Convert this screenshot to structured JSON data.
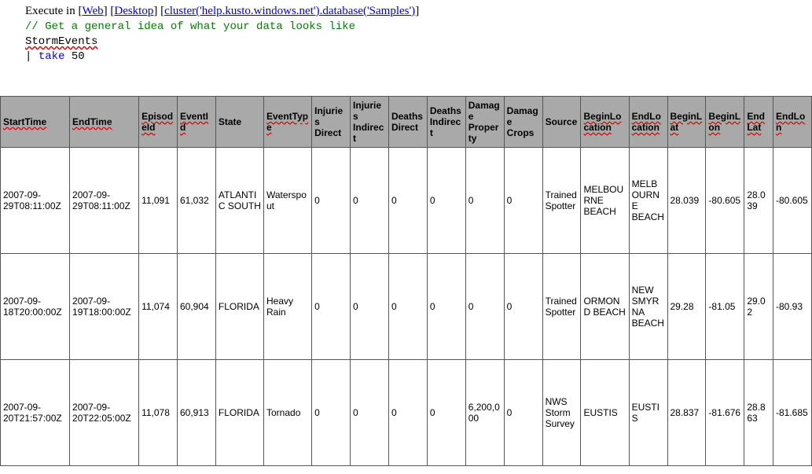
{
  "exec": {
    "prefix": "Execute in ",
    "web": "Web",
    "desktop": "Desktop",
    "cluster": "cluster('help.kusto.windows.net').database('Samples')"
  },
  "code": {
    "comment": "// Get a general idea of what your data looks like",
    "table": "StormEvents",
    "pipe": "| ",
    "take_kw": "take",
    "take_arg": " 50"
  },
  "headers": [
    {
      "t": "StartTime",
      "wavy": true
    },
    {
      "t": "EndTime",
      "wavy": true
    },
    {
      "t": "EpisodeId",
      "wavy": true
    },
    {
      "t": "EventId",
      "wavy": true
    },
    {
      "t": "State",
      "wavy": false
    },
    {
      "t": "EventType",
      "wavy": true
    },
    {
      "t": "Injuries Direct",
      "wavy": false
    },
    {
      "t": "Injuries Indirect",
      "wavy": false
    },
    {
      "t": "Deaths Direct",
      "wavy": false
    },
    {
      "t": "Deaths Indirect",
      "wavy": false
    },
    {
      "t": "Damage Property",
      "wavy": false
    },
    {
      "t": "Damage Crops",
      "wavy": false
    },
    {
      "t": "Source",
      "wavy": false
    },
    {
      "t": "BeginLocation",
      "wavy": true
    },
    {
      "t": "EndLocation",
      "wavy": true
    },
    {
      "t": "BeginLat",
      "wavy": true
    },
    {
      "t": "BeginLon",
      "wavy": true
    },
    {
      "t": "EndLat",
      "wavy": true
    },
    {
      "t": "EndLon",
      "wavy": true
    }
  ],
  "rows": [
    [
      "2007-09-29T08:11:00Z",
      "2007-09-29T08:11:00Z",
      "11,091",
      "61,032",
      "ATLANTIC SOUTH",
      "Waterspout",
      "0",
      "0",
      "0",
      "0",
      "0",
      "0",
      "Trained Spotter",
      "MELBOURNE BEACH",
      "MELBOURNE BEACH",
      "28.039",
      "-80.605",
      "28.039",
      "-80.605"
    ],
    [
      "2007-09-18T20:00:00Z",
      "2007-09-19T18:00:00Z",
      "11,074",
      "60,904",
      "FLORIDA",
      "Heavy Rain",
      "0",
      "0",
      "0",
      "0",
      "0",
      "0",
      "Trained Spotter",
      "ORMOND BEACH",
      "NEW SMYRNA BEACH",
      "29.28",
      "-81.05",
      "29.02",
      "-80.93"
    ],
    [
      "2007-09-20T21:57:00Z",
      "2007-09-20T22:05:00Z",
      "11,078",
      "60,913",
      "FLORIDA",
      "Tornado",
      "0",
      "0",
      "0",
      "0",
      "6,200,000",
      "0",
      "NWS Storm Survey",
      "EUSTIS",
      "EUSTIS",
      "28.837",
      "-81.676",
      "28.863",
      "-81.685"
    ]
  ],
  "colwidths": [
    "col-wide",
    "col-wide",
    "col-narrow",
    "col-narrow",
    "col-med",
    "col-med",
    "col-narrow",
    "col-narrow",
    "col-narrow",
    "col-narrow",
    "col-narrow",
    "col-narrow",
    "col-narrow",
    "col-med",
    "col-narrow",
    "col-narrow",
    "col-narrow",
    "col-small",
    "col-narrow"
  ]
}
